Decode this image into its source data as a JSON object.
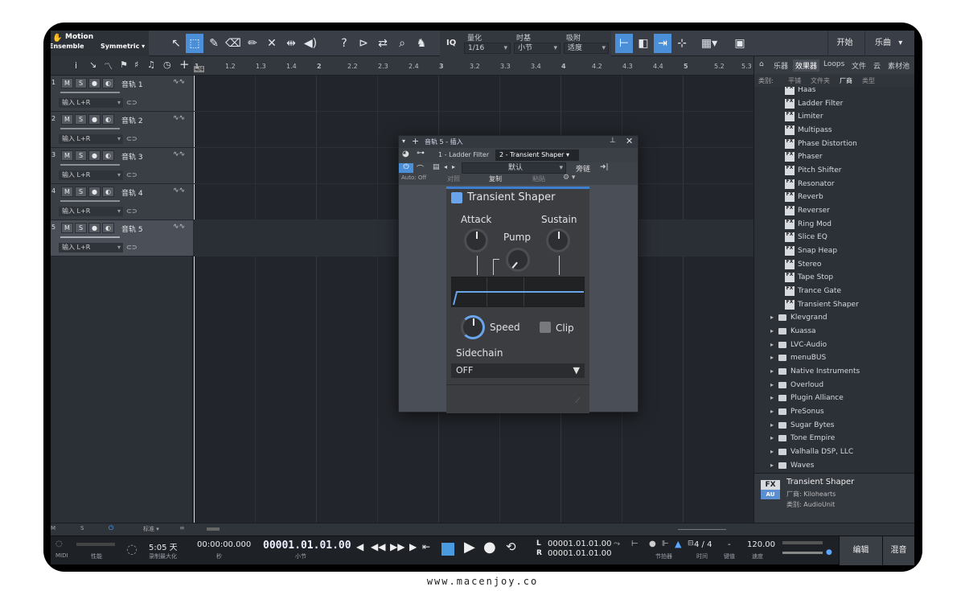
{
  "toolbar": {
    "preset_name": "Motion",
    "preset_sub": "Ensemble",
    "mode": "Symmetric",
    "iq_label": "IQ",
    "quantize_label": "量化",
    "quantize_value": "1/16",
    "timebase_label": "时基",
    "timebase_value": "小节",
    "snap_label": "吸附",
    "snap_value": "适度",
    "start_label": "开始",
    "song_label": "乐曲"
  },
  "ruler": {
    "ticks": [
      "1",
      "1.2",
      "1.3",
      "1.4",
      "2",
      "2.2",
      "2.3",
      "2.4",
      "3",
      "3.2",
      "3.3",
      "3.4",
      "4",
      "4.2",
      "4.3",
      "4.4",
      "5",
      "5.2",
      "5.3"
    ],
    "sig": "4/4"
  },
  "tracks": [
    {
      "num": "1",
      "name": "音轨 1",
      "input": "输入 L+R"
    },
    {
      "num": "2",
      "name": "音轨 2",
      "input": "输入 L+R"
    },
    {
      "num": "3",
      "name": "音轨 3",
      "input": "输入 L+R"
    },
    {
      "num": "4",
      "name": "音轨 4",
      "input": "输入 L+R"
    },
    {
      "num": "5",
      "name": "音轨 5",
      "input": "输入 L+R"
    }
  ],
  "track_buttons": {
    "m": "M",
    "s": "S"
  },
  "left_bottom": {
    "m": "M",
    "s": "S",
    "std": "标准"
  },
  "browser": {
    "tabs": [
      "乐器",
      "效果器",
      "Loops",
      "文件",
      "云",
      "素材池"
    ],
    "filter_label": "类别:",
    "filters": [
      "平铺",
      "文件夹",
      "厂商",
      "类型"
    ],
    "effects": [
      "Haas",
      "Ladder Filter",
      "Limiter",
      "Multipass",
      "Phase Distortion",
      "Phaser",
      "Pitch Shifter",
      "Resonator",
      "Reverb",
      "Reverser",
      "Ring Mod",
      "Slice EQ",
      "Snap Heap",
      "Stereo",
      "Tape Stop",
      "Trance Gate",
      "Transient Shaper"
    ],
    "fx_icon": "FX",
    "vendors": [
      "Klevgrand",
      "Kuassa",
      "LVC-Audio",
      "menuBUS",
      "Native Instruments",
      "Overloud",
      "Plugin Alliance",
      "PreSonus",
      "Sugar Bytes",
      "Tone Empire",
      "Valhalla DSP, LLC",
      "Waves"
    ],
    "info_title": "Transient Shaper",
    "info_vendor": "厂商:   Kilohearts",
    "info_type": "类别:   AudioUnit",
    "info_icon_top": "FX",
    "info_icon_bot": "AU"
  },
  "plugin": {
    "title": "音轨 5 - 插入",
    "tab1": "1 - Ladder Filter",
    "tab2": "2 - Transient Shaper",
    "preset": "默认",
    "sidechain_btn": "旁链",
    "auto": "Auto: Off",
    "compare": "对照",
    "copy": "复制",
    "paste": "粘贴",
    "name": "Transient Shaper",
    "attack": "Attack",
    "sustain": "Sustain",
    "pump": "Pump",
    "speed": "Speed",
    "clip": "Clip",
    "sidechain": "Sidechain",
    "sidechain_value": "OFF"
  },
  "transport": {
    "midi": "MIDI",
    "perf": "性能",
    "rec_time": "5:05 天",
    "rec_label": "录制最大化",
    "seconds": "00:00:00.000",
    "seconds_label": "秒",
    "bars": "00001.01.01.00",
    "bars_label": "小节",
    "l_label": "L",
    "r_label": "R",
    "loop_l": "00001.01.01.00",
    "loop_r": "00001.01.01.00",
    "metro_label": "节拍器",
    "time_sig": "4 / 4",
    "time_label": "时间",
    "key": "-",
    "key_label": "键值",
    "tempo": "120.00",
    "tempo_label": "速度",
    "edit": "编辑",
    "mix": "混音"
  }
}
